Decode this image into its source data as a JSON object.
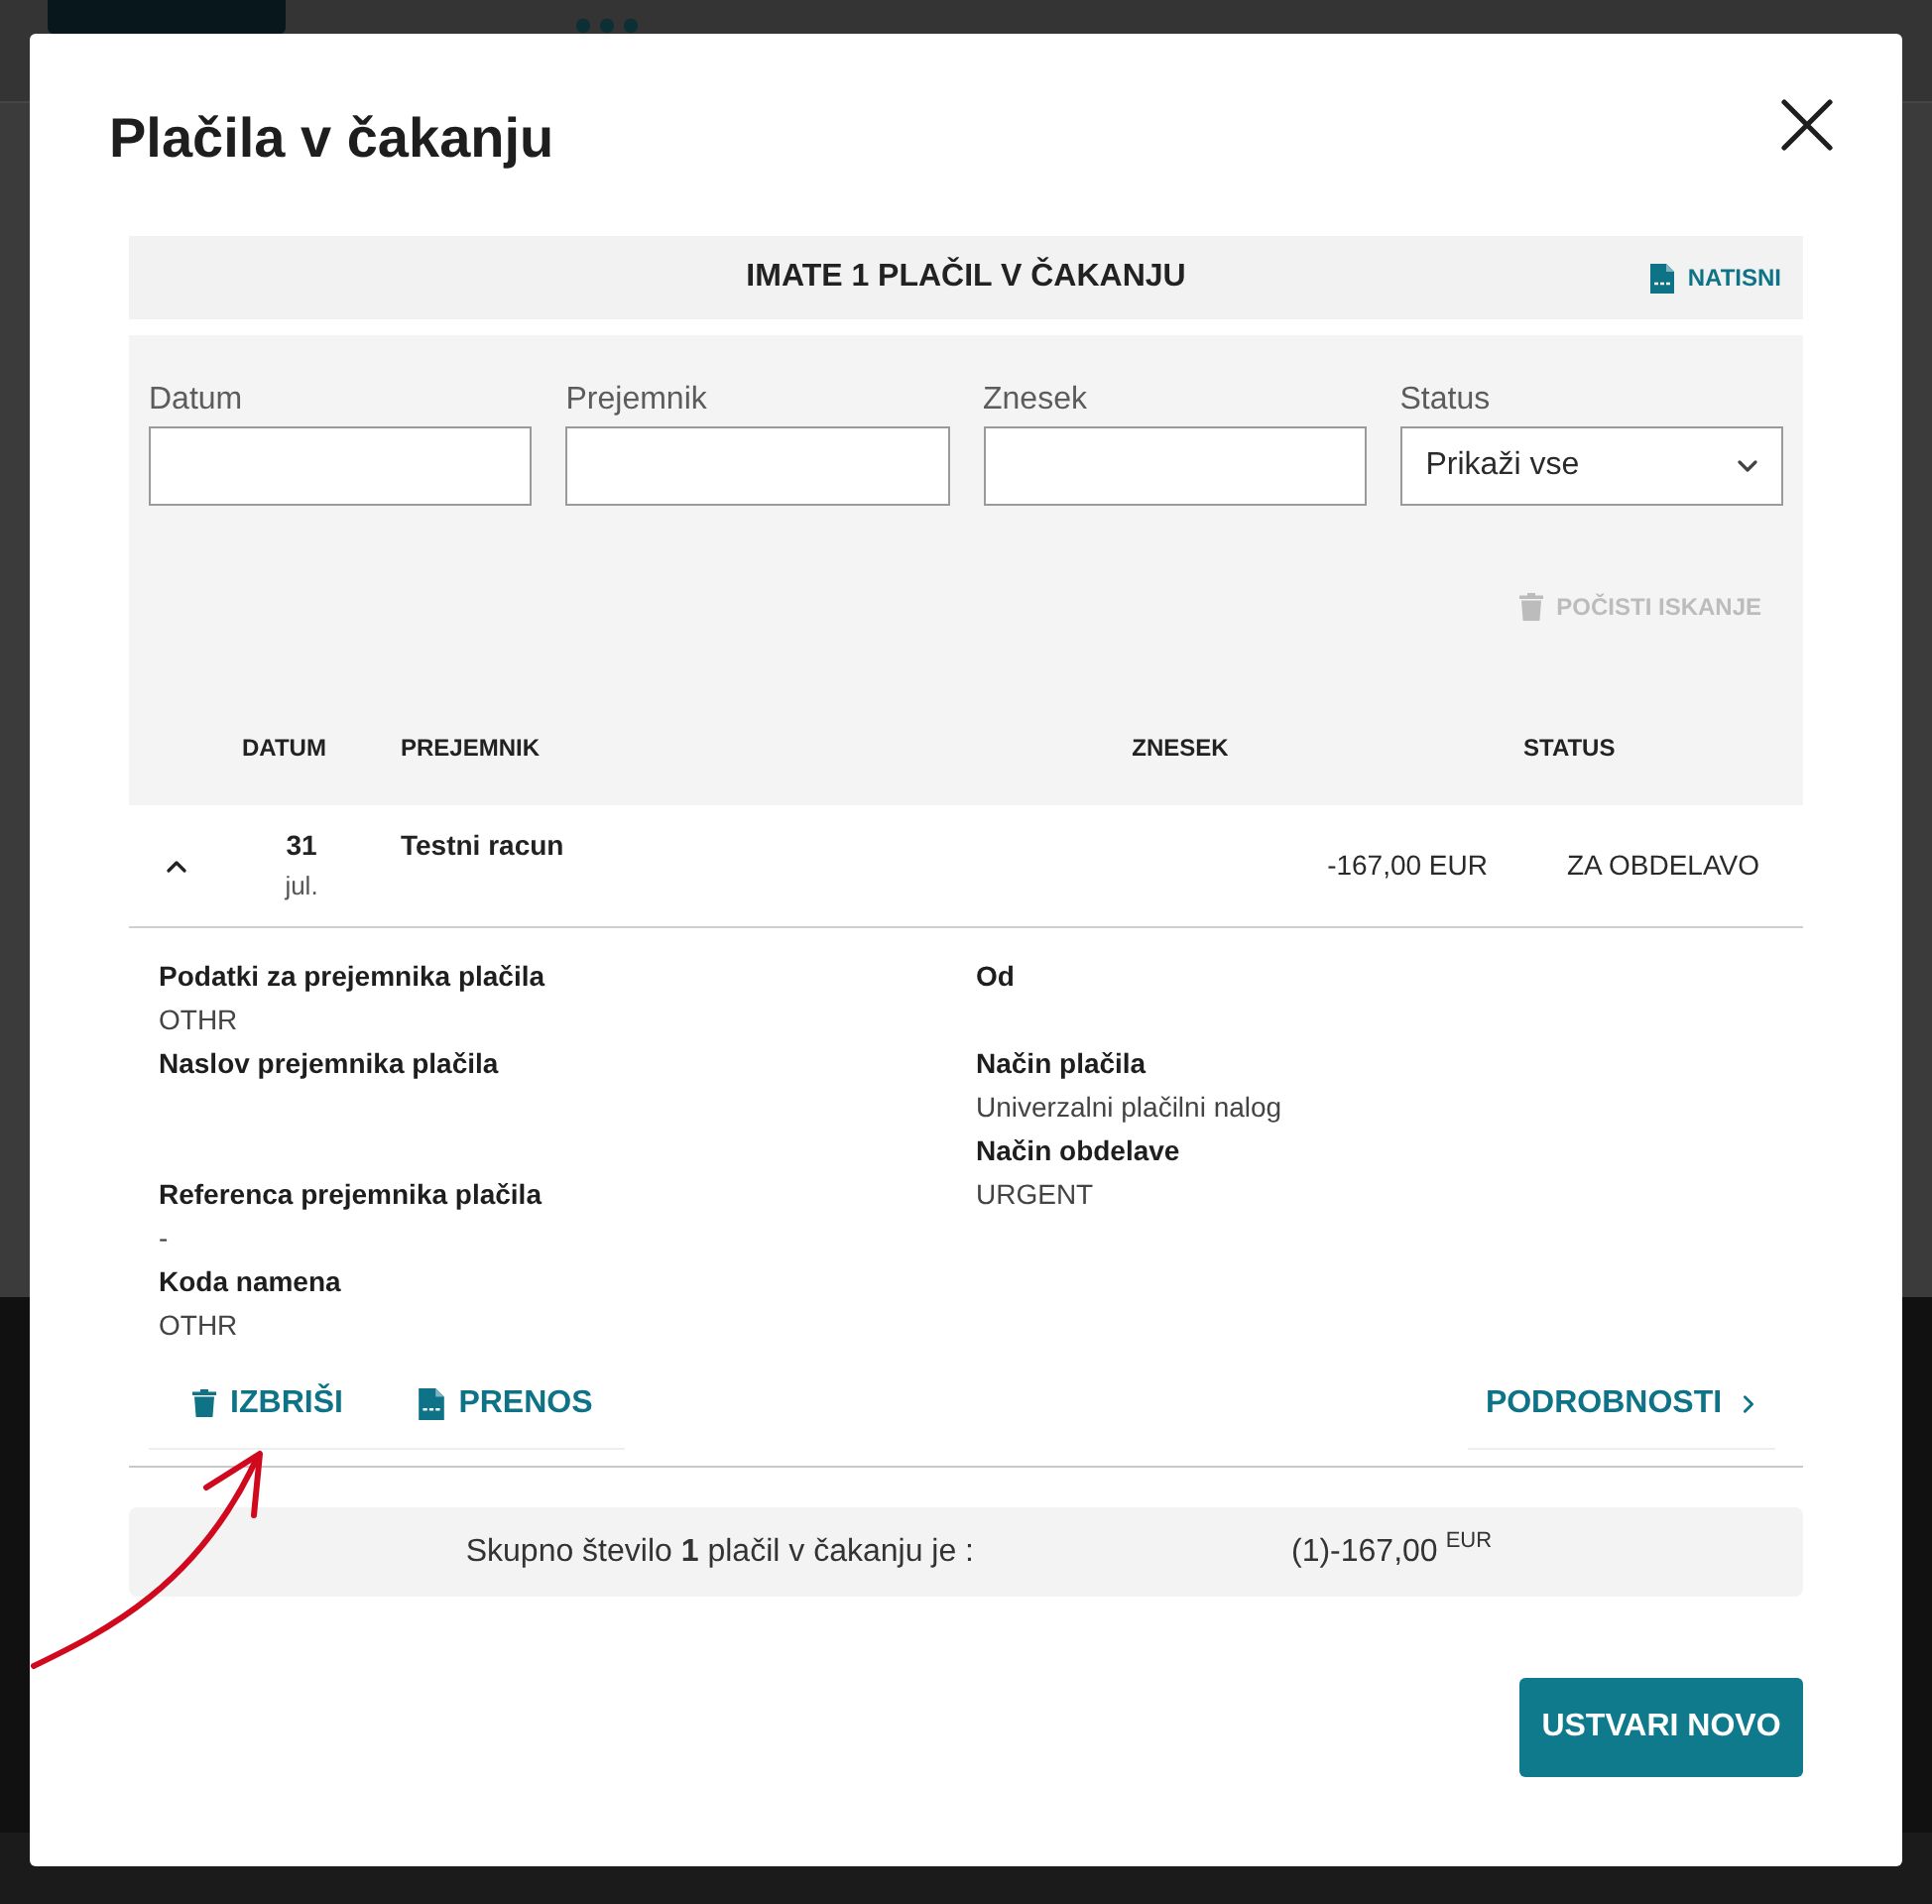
{
  "dialog": {
    "title": "Plačila v čakanju"
  },
  "summary_header": {
    "title": "IMATE 1 PLAČIL V ČAKANJU",
    "print_link": "NATISNI"
  },
  "filters": {
    "fields": [
      {
        "label": "Datum",
        "kind": "text"
      },
      {
        "label": "Prejemnik",
        "kind": "text"
      },
      {
        "label": "Znesek",
        "kind": "text"
      },
      {
        "label": "Status",
        "kind": "select",
        "value": "Prikaži vse"
      }
    ],
    "clear_button": {
      "label": "POČISTI ISKANJE",
      "disabled": true
    }
  },
  "table": {
    "columns": [
      "DATUM",
      "PREJEMNIK",
      "ZNESEK",
      "STATUS"
    ],
    "rows": [
      {
        "expanded": true,
        "day": "31",
        "month": "jul.",
        "recipient": "Testni racun",
        "amount": "-167,00 EUR",
        "status": "ZA OBDELAVO",
        "details": {
          "left": [
            {
              "label": "Podatki za prejemnika plačila",
              "value": "OTHR"
            },
            {
              "label": "Naslov prejemnika plačila"
            },
            {
              "label": "Referenca prejemnika plačila",
              "value": "-"
            },
            {
              "label": "Koda namena",
              "value": "OTHR"
            }
          ],
          "right": [
            {
              "label": "Od"
            },
            {
              "label": "Način plačila",
              "value": "Univerzalni plačilni nalog"
            },
            {
              "label": "Način obdelave",
              "value": "URGENT"
            }
          ]
        },
        "actions": [
          {
            "label": "IZBRIŠI",
            "kind": "delete"
          },
          {
            "label": "PRENOS",
            "kind": "pdf"
          }
        ],
        "details_link": "PODROBNOSTI"
      }
    ]
  },
  "total": {
    "text": "Skupno število **1** plačil v čakanju je :",
    "amount": "(1)-167,00",
    "currency": "EUR"
  },
  "buttons": [
    {
      "label": "USTVARI NOVO"
    }
  ],
  "annotations": [
    {
      "kind": "arrow"
    }
  ]
}
